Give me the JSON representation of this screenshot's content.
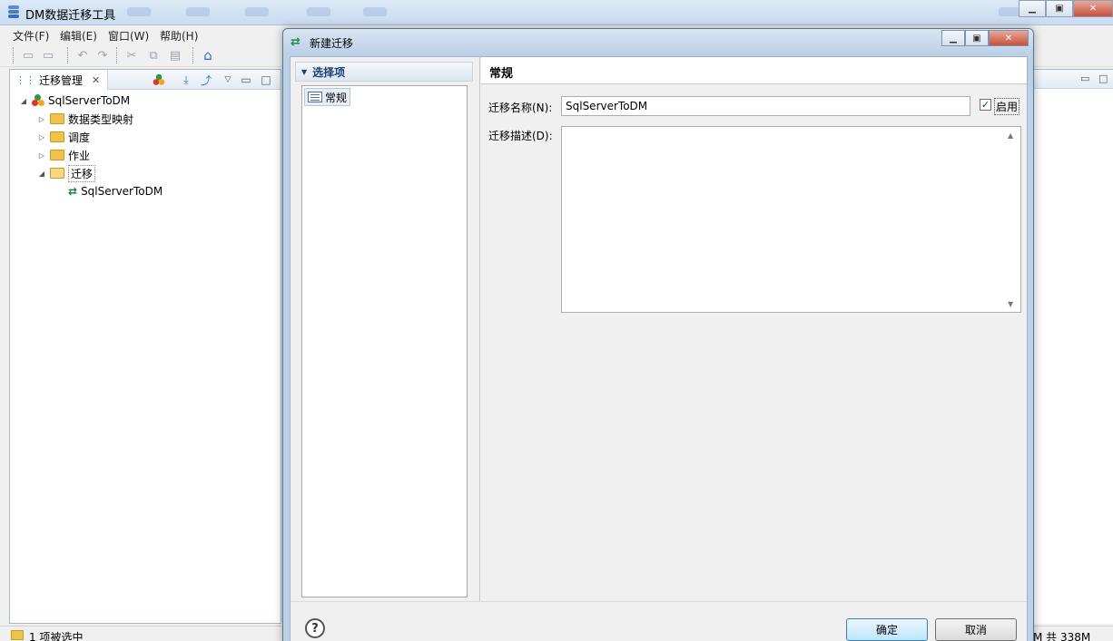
{
  "app": {
    "title": "DM数据迁移工具"
  },
  "menu": {
    "items": [
      "文件(F)",
      "编辑(E)",
      "窗口(W)",
      "帮助(H)"
    ]
  },
  "left_panel": {
    "tab_label": "迁移管理",
    "tree": {
      "root": "SqlServerToDM",
      "children": [
        {
          "label": "数据类型映射",
          "expanded": false
        },
        {
          "label": "调度",
          "expanded": false
        },
        {
          "label": "作业",
          "expanded": false
        },
        {
          "label": "迁移",
          "expanded": true,
          "children": [
            "SqlServerToDM"
          ]
        }
      ]
    }
  },
  "status": {
    "selection": "1 项被选中",
    "memory": "M 共 338M"
  },
  "dialog": {
    "title": "新建迁移",
    "nav_header": "选择项",
    "nav_items": [
      "常规"
    ],
    "section_title": "常规",
    "name_label": "迁移名称(N):",
    "name_value": "SqlServerToDM",
    "enable_label": "启用",
    "enable_checked": true,
    "desc_label": "迁移描述(D):",
    "desc_value": "",
    "ok_label": "确定",
    "cancel_label": "取消",
    "help_symbol": "?"
  },
  "colors": {
    "accent": "#3c7fb1",
    "folder": "#f0c24b",
    "nav_header_text": "#1c3e73"
  }
}
